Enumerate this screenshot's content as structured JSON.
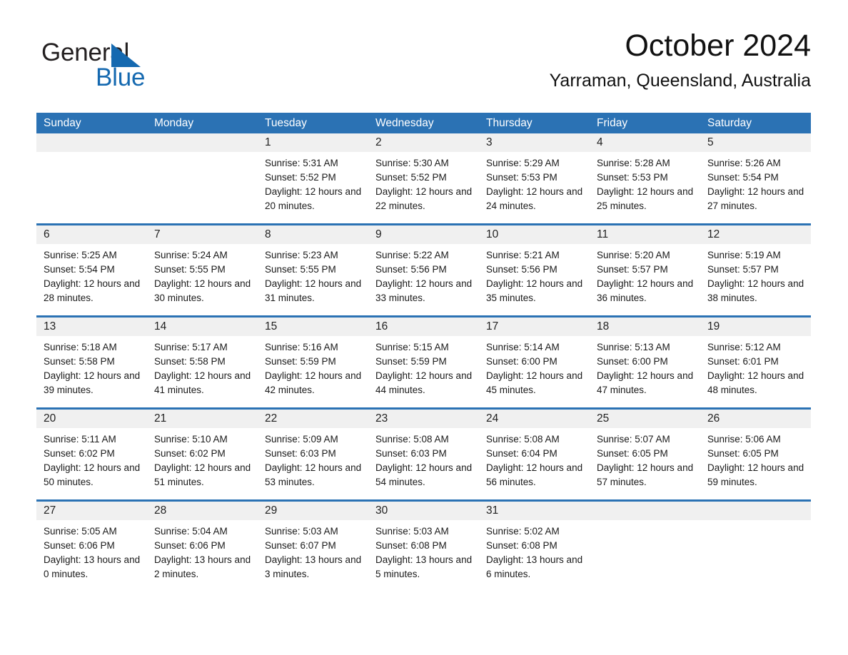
{
  "brand": {
    "line1": "General",
    "line2": "Blue",
    "triangle_color": "#1569b0",
    "icon": "triangle-icon"
  },
  "header": {
    "title": "October 2024",
    "subtitle": "Yarraman, Queensland, Australia"
  },
  "theme": {
    "header_blue": "#2b72b4",
    "daynum_band": "#f0f0f0",
    "text": "#1a1a1a",
    "brand_blue": "#1569b0"
  },
  "weekdays": [
    "Sunday",
    "Monday",
    "Tuesday",
    "Wednesday",
    "Thursday",
    "Friday",
    "Saturday"
  ],
  "weeks": [
    {
      "days": [
        {
          "num": "",
          "empty": true,
          "sunrise": "",
          "sunset": "",
          "daylight": ""
        },
        {
          "num": "",
          "empty": true,
          "sunrise": "",
          "sunset": "",
          "daylight": ""
        },
        {
          "num": "1",
          "sunrise": "Sunrise: 5:31 AM",
          "sunset": "Sunset: 5:52 PM",
          "daylight": "Daylight: 12 hours and 20 minutes."
        },
        {
          "num": "2",
          "sunrise": "Sunrise: 5:30 AM",
          "sunset": "Sunset: 5:52 PM",
          "daylight": "Daylight: 12 hours and 22 minutes."
        },
        {
          "num": "3",
          "sunrise": "Sunrise: 5:29 AM",
          "sunset": "Sunset: 5:53 PM",
          "daylight": "Daylight: 12 hours and 24 minutes."
        },
        {
          "num": "4",
          "sunrise": "Sunrise: 5:28 AM",
          "sunset": "Sunset: 5:53 PM",
          "daylight": "Daylight: 12 hours and 25 minutes."
        },
        {
          "num": "5",
          "sunrise": "Sunrise: 5:26 AM",
          "sunset": "Sunset: 5:54 PM",
          "daylight": "Daylight: 12 hours and 27 minutes."
        }
      ]
    },
    {
      "days": [
        {
          "num": "6",
          "sunrise": "Sunrise: 5:25 AM",
          "sunset": "Sunset: 5:54 PM",
          "daylight": "Daylight: 12 hours and 28 minutes."
        },
        {
          "num": "7",
          "sunrise": "Sunrise: 5:24 AM",
          "sunset": "Sunset: 5:55 PM",
          "daylight": "Daylight: 12 hours and 30 minutes."
        },
        {
          "num": "8",
          "sunrise": "Sunrise: 5:23 AM",
          "sunset": "Sunset: 5:55 PM",
          "daylight": "Daylight: 12 hours and 31 minutes."
        },
        {
          "num": "9",
          "sunrise": "Sunrise: 5:22 AM",
          "sunset": "Sunset: 5:56 PM",
          "daylight": "Daylight: 12 hours and 33 minutes."
        },
        {
          "num": "10",
          "sunrise": "Sunrise: 5:21 AM",
          "sunset": "Sunset: 5:56 PM",
          "daylight": "Daylight: 12 hours and 35 minutes."
        },
        {
          "num": "11",
          "sunrise": "Sunrise: 5:20 AM",
          "sunset": "Sunset: 5:57 PM",
          "daylight": "Daylight: 12 hours and 36 minutes."
        },
        {
          "num": "12",
          "sunrise": "Sunrise: 5:19 AM",
          "sunset": "Sunset: 5:57 PM",
          "daylight": "Daylight: 12 hours and 38 minutes."
        }
      ]
    },
    {
      "days": [
        {
          "num": "13",
          "sunrise": "Sunrise: 5:18 AM",
          "sunset": "Sunset: 5:58 PM",
          "daylight": "Daylight: 12 hours and 39 minutes."
        },
        {
          "num": "14",
          "sunrise": "Sunrise: 5:17 AM",
          "sunset": "Sunset: 5:58 PM",
          "daylight": "Daylight: 12 hours and 41 minutes."
        },
        {
          "num": "15",
          "sunrise": "Sunrise: 5:16 AM",
          "sunset": "Sunset: 5:59 PM",
          "daylight": "Daylight: 12 hours and 42 minutes."
        },
        {
          "num": "16",
          "sunrise": "Sunrise: 5:15 AM",
          "sunset": "Sunset: 5:59 PM",
          "daylight": "Daylight: 12 hours and 44 minutes."
        },
        {
          "num": "17",
          "sunrise": "Sunrise: 5:14 AM",
          "sunset": "Sunset: 6:00 PM",
          "daylight": "Daylight: 12 hours and 45 minutes."
        },
        {
          "num": "18",
          "sunrise": "Sunrise: 5:13 AM",
          "sunset": "Sunset: 6:00 PM",
          "daylight": "Daylight: 12 hours and 47 minutes."
        },
        {
          "num": "19",
          "sunrise": "Sunrise: 5:12 AM",
          "sunset": "Sunset: 6:01 PM",
          "daylight": "Daylight: 12 hours and 48 minutes."
        }
      ]
    },
    {
      "days": [
        {
          "num": "20",
          "sunrise": "Sunrise: 5:11 AM",
          "sunset": "Sunset: 6:02 PM",
          "daylight": "Daylight: 12 hours and 50 minutes."
        },
        {
          "num": "21",
          "sunrise": "Sunrise: 5:10 AM",
          "sunset": "Sunset: 6:02 PM",
          "daylight": "Daylight: 12 hours and 51 minutes."
        },
        {
          "num": "22",
          "sunrise": "Sunrise: 5:09 AM",
          "sunset": "Sunset: 6:03 PM",
          "daylight": "Daylight: 12 hours and 53 minutes."
        },
        {
          "num": "23",
          "sunrise": "Sunrise: 5:08 AM",
          "sunset": "Sunset: 6:03 PM",
          "daylight": "Daylight: 12 hours and 54 minutes."
        },
        {
          "num": "24",
          "sunrise": "Sunrise: 5:08 AM",
          "sunset": "Sunset: 6:04 PM",
          "daylight": "Daylight: 12 hours and 56 minutes."
        },
        {
          "num": "25",
          "sunrise": "Sunrise: 5:07 AM",
          "sunset": "Sunset: 6:05 PM",
          "daylight": "Daylight: 12 hours and 57 minutes."
        },
        {
          "num": "26",
          "sunrise": "Sunrise: 5:06 AM",
          "sunset": "Sunset: 6:05 PM",
          "daylight": "Daylight: 12 hours and 59 minutes."
        }
      ]
    },
    {
      "days": [
        {
          "num": "27",
          "sunrise": "Sunrise: 5:05 AM",
          "sunset": "Sunset: 6:06 PM",
          "daylight": "Daylight: 13 hours and 0 minutes."
        },
        {
          "num": "28",
          "sunrise": "Sunrise: 5:04 AM",
          "sunset": "Sunset: 6:06 PM",
          "daylight": "Daylight: 13 hours and 2 minutes."
        },
        {
          "num": "29",
          "sunrise": "Sunrise: 5:03 AM",
          "sunset": "Sunset: 6:07 PM",
          "daylight": "Daylight: 13 hours and 3 minutes."
        },
        {
          "num": "30",
          "sunrise": "Sunrise: 5:03 AM",
          "sunset": "Sunset: 6:08 PM",
          "daylight": "Daylight: 13 hours and 5 minutes."
        },
        {
          "num": "31",
          "sunrise": "Sunrise: 5:02 AM",
          "sunset": "Sunset: 6:08 PM",
          "daylight": "Daylight: 13 hours and 6 minutes."
        },
        {
          "num": "",
          "empty": true,
          "sunrise": "",
          "sunset": "",
          "daylight": ""
        },
        {
          "num": "",
          "empty": true,
          "sunrise": "",
          "sunset": "",
          "daylight": ""
        }
      ]
    }
  ]
}
